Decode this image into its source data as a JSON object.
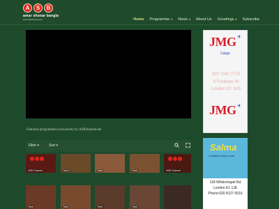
{
  "logo": {
    "letters": [
      "A",
      "S",
      "B"
    ],
    "title": "amar shonar bangla",
    "subtitle": "www.asbchannel.net"
  },
  "nav": [
    {
      "label": "Home",
      "active": true,
      "dropdown": false
    },
    {
      "label": "Programme",
      "active": false,
      "dropdown": true
    },
    {
      "label": "News",
      "active": false,
      "dropdown": true
    },
    {
      "label": "About Us",
      "active": false,
      "dropdown": false
    },
    {
      "label": "Greetings",
      "active": false,
      "dropdown": true
    },
    {
      "label": "Subscribe",
      "active": false,
      "dropdown": false
    }
  ],
  "caption": "Featured programmes exclusively by ASBchannel.net",
  "playlist": {
    "filter_label": "Filter",
    "sort_label": "Sort"
  },
  "thumbnails": [
    {
      "label": "ASB Channel",
      "bg": "#5a1a14"
    },
    {
      "label": "Tune 4",
      "bg": "#6b4a2a"
    },
    {
      "label": "Tune",
      "bg": "#8a5a3a"
    },
    {
      "label": "Tune",
      "bg": "#7a5232"
    },
    {
      "label": "ASB Channel",
      "bg": "#4a1a12"
    },
    {
      "label": "Tune",
      "bg": "#6a3a26"
    },
    {
      "label": "Tune",
      "bg": "#7a4a2e"
    },
    {
      "label": "Tune",
      "bg": "#5a3a2a"
    },
    {
      "label": "Tune",
      "bg": "#6a4636"
    }
  ],
  "ads": {
    "jmg": {
      "logo_text": "JMG",
      "cargo": "Cargo",
      "phone": "020 7247 7770",
      "address1": "8 Fordham St",
      "address2": "London E1 1HS"
    },
    "salma": {
      "title": "Salma",
      "subtitle": "a designer abaya house",
      "address1": "118 Whitechapel Rd",
      "address2": "London E1 1JE",
      "phone": "Phone:020 8127 0016"
    }
  },
  "colors": {
    "background": "#1e4a2c",
    "nav_active": "#d8e27a",
    "logo_red": "#e0241c",
    "jmg_red": "#d4202e"
  }
}
